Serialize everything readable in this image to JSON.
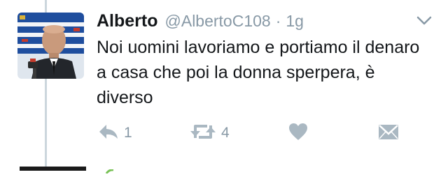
{
  "tweet": {
    "display_name": "Alberto",
    "handle": "@AlbertoC108",
    "separator": "·",
    "time": "1g",
    "text": "Noi uomini lavoriamo e portiamo il denaro a casa che poi la donna sperpera, è diverso"
  },
  "actions": {
    "reply_count": "1",
    "retweet_count": "4",
    "reply_icon": "reply-icon",
    "retweet_icon": "retweet-icon",
    "like_icon": "heart-icon",
    "dm_icon": "envelope-icon"
  },
  "colors": {
    "text": "#14171a",
    "secondary": "#8899a6",
    "icon": "#aab8c2",
    "thread_line": "#ccd6dd"
  }
}
